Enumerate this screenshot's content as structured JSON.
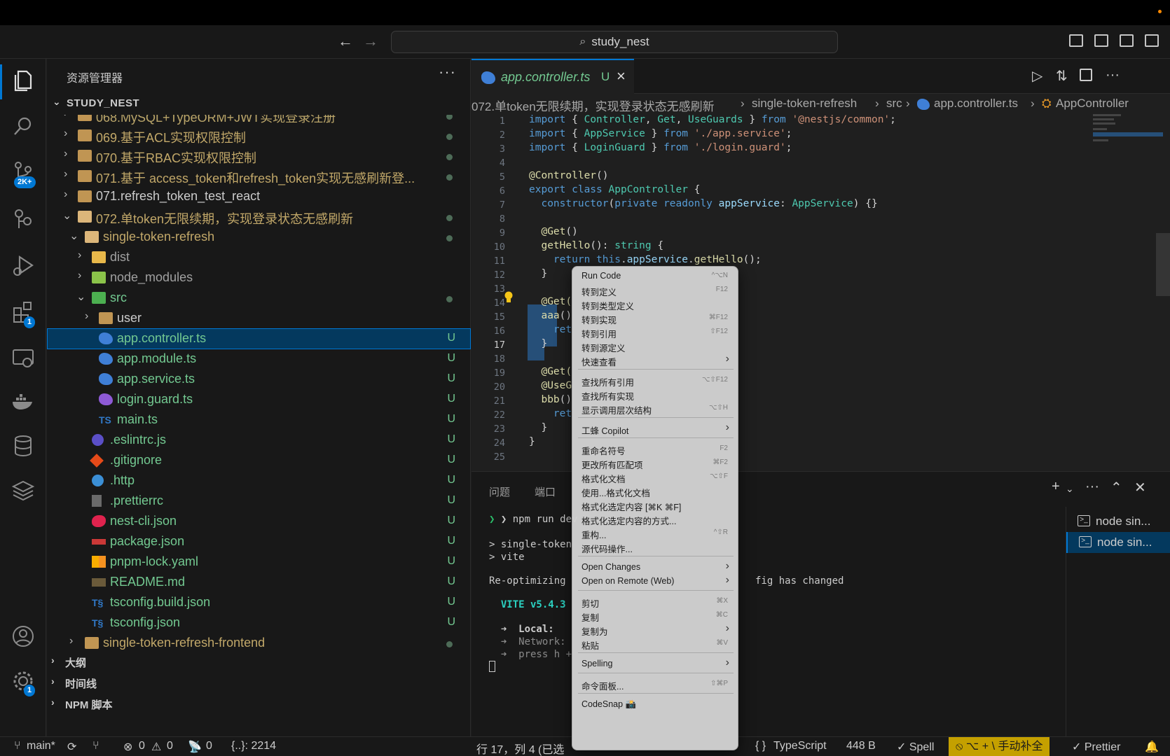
{
  "window": {
    "title": "study_nest"
  },
  "activity_bar": {
    "scm_badge": "2K+",
    "extensions_badge": "1",
    "settings_badge": "1"
  },
  "sidebar": {
    "header": "资源管理器",
    "more": "···",
    "root": "STUDY_NEST",
    "tree": [
      {
        "label": "068.MySQL+TypeORM+JWT实现登录注册",
        "level": 1
      },
      {
        "label": "069.基于ACL实现权限控制",
        "level": 1
      },
      {
        "label": "070.基于RBAC实现权限控制",
        "level": 1
      },
      {
        "label": "071.基于 access_token和refresh_token实现无感刷新登...",
        "level": 1
      },
      {
        "label": "071.refresh_token_test_react",
        "level": 1
      },
      {
        "label": "072.单token无限续期，实现登录状态无感刷新",
        "level": 1
      },
      {
        "label": "single-token-refresh",
        "level": 2
      },
      {
        "label": "dist",
        "level": 3
      },
      {
        "label": "node_modules",
        "level": 3
      },
      {
        "label": "src",
        "level": 3
      },
      {
        "label": "user",
        "level": 4
      },
      {
        "label": "app.controller.ts",
        "status": "U"
      },
      {
        "label": "app.module.ts",
        "status": "U"
      },
      {
        "label": "app.service.ts",
        "status": "U"
      },
      {
        "label": "login.guard.ts",
        "status": "U"
      },
      {
        "label": "main.ts",
        "status": "U",
        "icon_text": "TS"
      },
      {
        "label": ".eslintrc.js",
        "status": "U"
      },
      {
        "label": ".gitignore",
        "status": "U"
      },
      {
        "label": ".http",
        "status": "U"
      },
      {
        "label": ".prettierrc",
        "status": "U"
      },
      {
        "label": "nest-cli.json",
        "status": "U"
      },
      {
        "label": "package.json",
        "status": "U"
      },
      {
        "label": "pnpm-lock.yaml",
        "status": "U"
      },
      {
        "label": "README.md",
        "status": "U"
      },
      {
        "label": "tsconfig.build.json",
        "status": "U"
      },
      {
        "label": "tsconfig.json",
        "status": "U"
      },
      {
        "label": "single-token-refresh-frontend",
        "level": 2
      }
    ],
    "sections": [
      "大纲",
      "时间线",
      "NPM 脚本"
    ]
  },
  "editor": {
    "tab": {
      "name": "app.controller.ts",
      "mark": "U"
    },
    "breadcrumbs": [
      "072.单token无限续期，实现登录状态无感刷新",
      "single-token-refresh",
      "src",
      "app.controller.ts",
      "AppController"
    ],
    "line_numbers": [
      "1",
      "2",
      "3",
      "4",
      "5",
      "6",
      "7",
      "8",
      "9",
      "10",
      "11",
      "12",
      "13",
      "14",
      "15",
      "16",
      "17",
      "18",
      "19",
      "20",
      "21",
      "22",
      "23",
      "24",
      "25"
    ],
    "current_line": "17"
  },
  "panel": {
    "tabs": [
      "问题",
      "端口"
    ],
    "terminal_lines": [
      "❯ npm run dev",
      "",
      "> single-token",
      "> vite",
      "",
      "Re-optimizing",
      "",
      "  VITE v5.4.3",
      "",
      "  ➜  Local:",
      "  ➜  Network:",
      "  ➜  press h +"
    ],
    "terminal_tail": "fig has changed",
    "terminals": [
      "node sin...",
      "node sin..."
    ]
  },
  "context_menu": {
    "items": [
      {
        "label": "Run Code",
        "key": "^⌥N"
      },
      {
        "label": "转到定义",
        "key": "F12"
      },
      {
        "label": "转到类型定义",
        "key": ""
      },
      {
        "label": "转到实现",
        "key": "⌘F12"
      },
      {
        "label": "转到引用",
        "key": "⇧F12"
      },
      {
        "label": "转到源定义",
        "key": ""
      },
      {
        "label": "快速查看",
        "key": "",
        "sub": true
      },
      {
        "sep": true
      },
      {
        "label": "查找所有引用",
        "key": "⌥⇧F12"
      },
      {
        "label": "查找所有实现",
        "key": ""
      },
      {
        "label": "显示调用层次结构",
        "key": "⌥⇧H"
      },
      {
        "sep": true
      },
      {
        "label": "工蜂 Copilot",
        "key": "",
        "sub": true
      },
      {
        "sep": true
      },
      {
        "label": "重命名符号",
        "key": "F2"
      },
      {
        "label": "更改所有匹配项",
        "key": "⌘F2"
      },
      {
        "label": "格式化文档",
        "key": "⌥⇧F"
      },
      {
        "label": "使用...格式化文档",
        "key": ""
      },
      {
        "label": "格式化选定内容 [⌘K ⌘F]",
        "key": ""
      },
      {
        "label": "格式化选定内容的方式...",
        "key": ""
      },
      {
        "label": "重构...",
        "key": "^⇧R"
      },
      {
        "label": "源代码操作...",
        "key": ""
      },
      {
        "sep": true
      },
      {
        "label": "Open Changes",
        "key": "",
        "sub": true
      },
      {
        "label": "Open on Remote (Web)",
        "key": "",
        "sub": true
      },
      {
        "sep": true
      },
      {
        "label": "剪切",
        "key": "⌘X"
      },
      {
        "label": "复制",
        "key": "⌘C"
      },
      {
        "label": "复制为",
        "key": "",
        "sub": true
      },
      {
        "label": "粘贴",
        "key": "⌘V"
      },
      {
        "sep": true
      },
      {
        "label": "Spelling",
        "key": "",
        "sub": true
      },
      {
        "sep": true
      },
      {
        "label": "命令面板...",
        "key": "⇧⌘P"
      },
      {
        "sep": true
      },
      {
        "label": "CodeSnap 📸",
        "key": ""
      }
    ]
  },
  "statusbar": {
    "branch": "main*",
    "errors": "0",
    "warnings": "0",
    "ports": "0",
    "scope": "{..}: 2214",
    "position": "行 17，列 4 (已选",
    "language": "TypeScript",
    "size": "448 B",
    "spell": "✓ Spell",
    "input_method": "⌥ + \\ 手动补全",
    "prettier": "✓ Prettier",
    "braces": "{ }"
  },
  "colors": {
    "accent": "#0078d4",
    "untracked": "#73c991",
    "selection": "#264f78",
    "statusbar_highlight": "#c4a000"
  }
}
